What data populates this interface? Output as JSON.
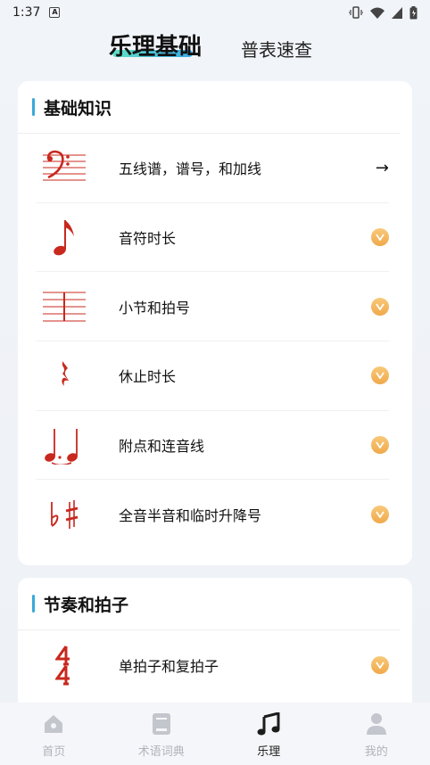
{
  "status_bar": {
    "time": "1:37",
    "a_icon": "A"
  },
  "header": {
    "active_tab": "乐理基础",
    "inactive_tab": "普表速查"
  },
  "sections": [
    {
      "title": "基础知识",
      "items": [
        {
          "label": "五线谱，谱号，和加线",
          "icon": "bass-clef-staff-icon",
          "end": "arrow",
          "arrow_text": "→"
        },
        {
          "label": "音符时长",
          "icon": "eighth-note-icon",
          "end": "check"
        },
        {
          "label": "小节和拍号",
          "icon": "staff-barline-icon",
          "end": "check"
        },
        {
          "label": "休止时长",
          "icon": "quarter-rest-icon",
          "end": "check"
        },
        {
          "label": "附点和连音线",
          "icon": "dotted-tie-notes-icon",
          "end": "check"
        },
        {
          "label": "全音半音和临时升降号",
          "icon": "flat-sharp-icon",
          "end": "check"
        }
      ]
    },
    {
      "title": "节奏和拍子",
      "items": [
        {
          "label": "单拍子和复拍子",
          "icon": "time-signature-icon",
          "end": "check"
        }
      ]
    }
  ],
  "bottom_nav": [
    {
      "label": "首页",
      "icon": "home-icon",
      "active": false
    },
    {
      "label": "术语词典",
      "icon": "dictionary-icon",
      "active": false
    },
    {
      "label": "乐理",
      "icon": "music-note-icon",
      "active": true
    },
    {
      "label": "我的",
      "icon": "profile-icon",
      "active": false
    }
  ],
  "colors": {
    "accent": "#38a9d9",
    "notation_red": "#c8281e",
    "badge": "#f0a94a"
  }
}
